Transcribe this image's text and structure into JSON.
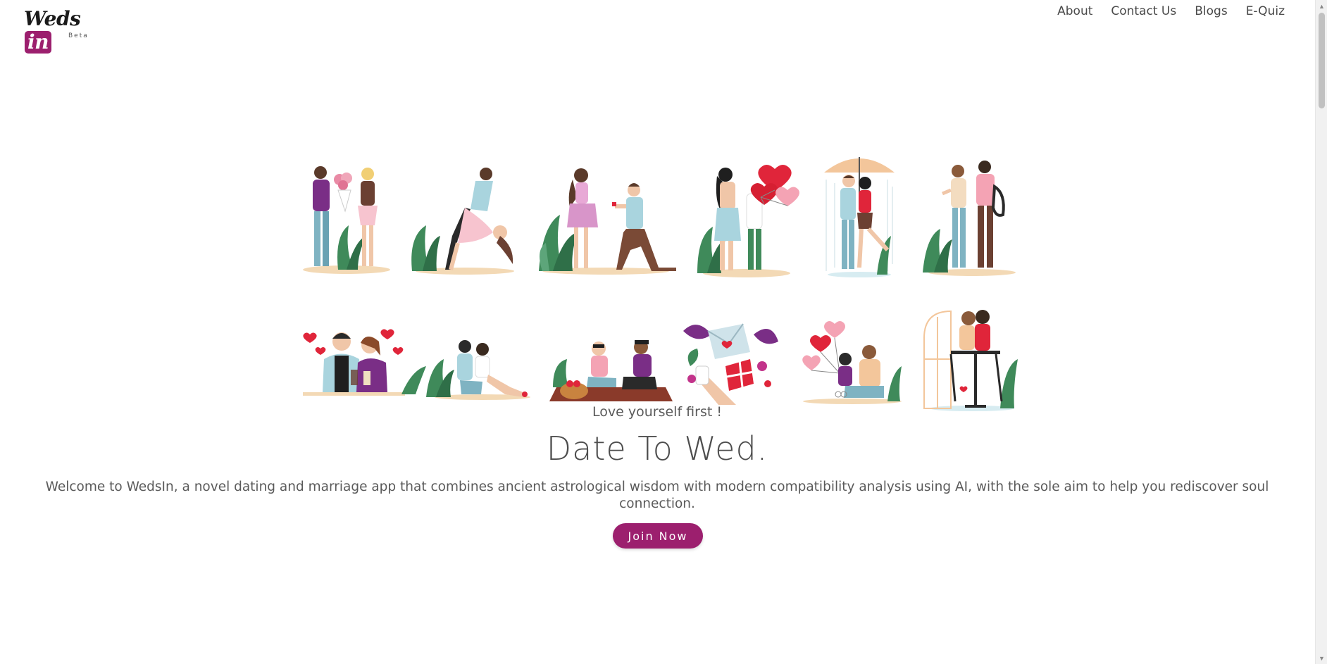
{
  "logo": {
    "word": "Weds",
    "in": "in",
    "beta": "Beta"
  },
  "nav": {
    "items": [
      "About",
      "Contact Us",
      "Blogs",
      "E-Quiz"
    ]
  },
  "hero": {
    "tagline": "Love yourself first !",
    "headline": "Date To Wed.",
    "intro": "Welcome to WedsIn, a novel dating and marriage app that combines ancient astrological wisdom with modern compatibility analysis using AI, with the sole aim to help you rediscover soul connection.",
    "cta_label": "Join Now"
  },
  "colors": {
    "brand": "#9c1f6e",
    "leaf": "#3f8a5a",
    "heart": "#e0253a",
    "sand": "#f3d9b5"
  },
  "icons": {
    "scroll_up": "triangle-up",
    "scroll_down": "triangle-down"
  }
}
